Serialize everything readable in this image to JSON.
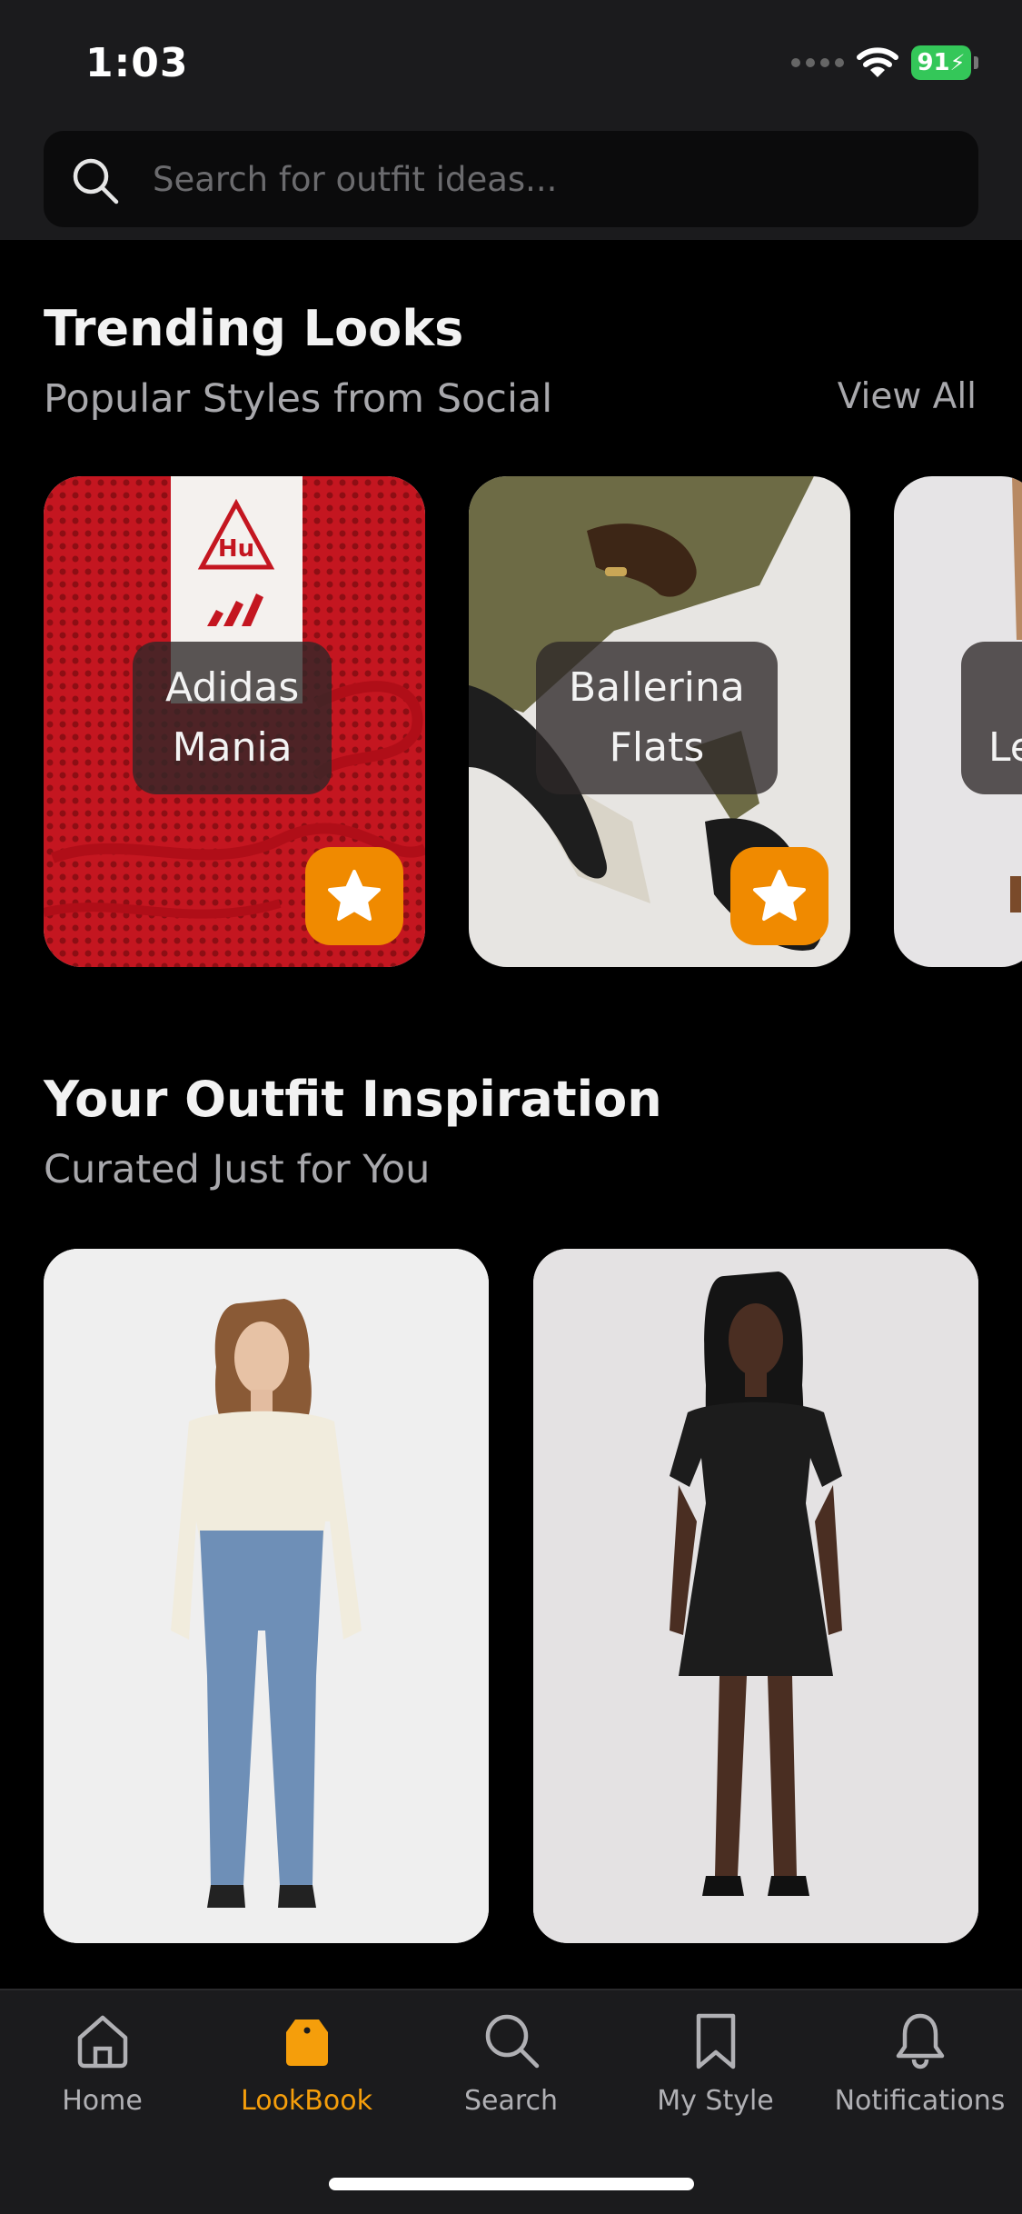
{
  "status": {
    "time": "1:03",
    "battery": "91"
  },
  "search": {
    "placeholder": "Search for outfit ideas..."
  },
  "trending": {
    "title": "Trending Looks",
    "subtitle": "Popular Styles from Social",
    "view_all": "View All",
    "cards": [
      {
        "label_line1": "Adidas",
        "label_line2": "Mania"
      },
      {
        "label_line1": "Ballerina",
        "label_line2": "Flats"
      },
      {
        "label_line1": "Le"
      }
    ]
  },
  "inspiration": {
    "title": "Your Outfit Inspiration",
    "subtitle": "Curated Just for You"
  },
  "tabs": [
    {
      "label": "Home",
      "icon": "home-icon"
    },
    {
      "label": "LookBook",
      "icon": "tag-icon",
      "active": true
    },
    {
      "label": "Search",
      "icon": "search-icon"
    },
    {
      "label": "My Style",
      "icon": "bookmark-icon"
    },
    {
      "label": "Notifications",
      "icon": "bell-icon"
    }
  ],
  "colors": {
    "accent": "#F59E0B",
    "star_button": "#F08A00",
    "battery": "#34C759"
  }
}
